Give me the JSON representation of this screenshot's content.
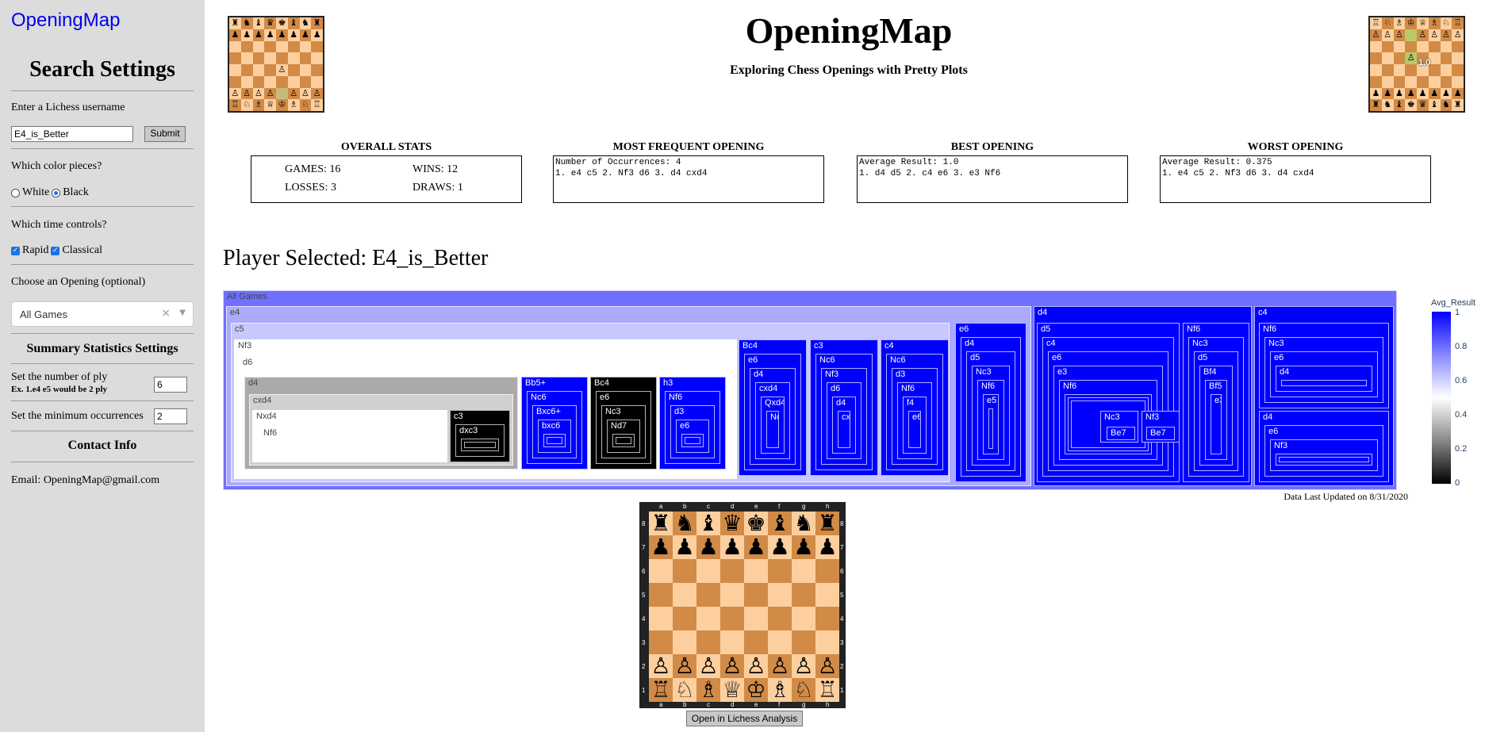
{
  "sidebar": {
    "brand": "OpeningMap",
    "heading": "Search Settings",
    "username_label": "Enter a Lichess username",
    "username_value": "E4_is_Better",
    "submit_label": "Submit",
    "color_label": "Which color pieces?",
    "color_options": [
      "White",
      "Black"
    ],
    "color_selected": "Black",
    "time_label": "Which time controls?",
    "time_options": [
      "Rapid",
      "Classical"
    ],
    "opening_label": "Choose an Opening (optional)",
    "opening_value": "All Games",
    "summary_heading": "Summary Statistics Settings",
    "ply_label": "Set the number of ply",
    "ply_hint": "Ex. 1.e4 e5 would be 2 ply",
    "ply_value": "6",
    "minocc_label": "Set the minimum occurrences",
    "minocc_value": "2",
    "contact_heading": "Contact Info",
    "email": "Email: OpeningMap@gmail.com"
  },
  "header": {
    "title": "OpeningMap",
    "subtitle": "Exploring Chess Openings with Pretty Plots",
    "right_board_overlay": "1.0"
  },
  "stats": {
    "overall_title": "OVERALL STATS",
    "games": "GAMES: 16",
    "wins": "WINS: 12",
    "losses": "LOSSES: 3",
    "draws": "DRAWS: 1",
    "frequent_title": "MOST FREQUENT OPENING",
    "frequent_line1": "Number of Occurrences: 4",
    "frequent_line2": "1. e4 c5 2. Nf3 d6 3. d4 cxd4",
    "best_title": "BEST OPENING",
    "best_line1": "Average Result: 1.0",
    "best_line2": "1. d4 d5 2. c4 e6 3. e3 Nf6",
    "worst_title": "WORST OPENING",
    "worst_line1": "Average Result: 0.375",
    "worst_line2": "1. e4 c5 2. Nf3 d6 3. d4 cxd4"
  },
  "player_heading": "Player Selected: E4_is_Better",
  "treemap": {
    "root_label": "All Games",
    "colorbar_title": "Avg_Result",
    "colorbar_ticks": [
      "1",
      "0.8",
      "0.6",
      "0.4",
      "0.2",
      "0"
    ],
    "labels": {
      "e4": "e4",
      "c5": "c5",
      "nf3": "Nf3",
      "d6": "d6",
      "d4": "d4",
      "cxd4": "cxd4",
      "nxd4": "Nxd4",
      "nf6": "Nf6",
      "c3": "c3",
      "dxc3": "dxc3",
      "bb5": "Bb5+",
      "nc6": "Nc6",
      "bxc6p": "Bxc6+",
      "bxc6": "bxc6",
      "bc4": "Bc4",
      "e6": "e6",
      "nc3": "Nc3",
      "nd7": "Nd7",
      "h3": "h3",
      "d3": "d3",
      "bc4b": "Bc4",
      "qxd4": "Qxd4",
      "c3b": "c3",
      "c4": "c4",
      "f4": "f4",
      "d5": "d5",
      "e5": "e5",
      "e3": "e3",
      "be7": "Be7",
      "bf4": "Bf4",
      "bf5": "Bf5"
    }
  },
  "updated": "Data Last Updated on 8/31/2020",
  "board": {
    "files": [
      "a",
      "b",
      "c",
      "d",
      "e",
      "f",
      "g",
      "h"
    ],
    "ranks": [
      "8",
      "7",
      "6",
      "5",
      "4",
      "3",
      "2",
      "1"
    ],
    "lichess_button": "Open in Lichess Analysis"
  },
  "colors": {
    "blue": "#0000ff",
    "mid_blue": "#6666ff",
    "light_blue": "#aaaaff",
    "sidebar": "#dcdcdc",
    "light_square": "#fecf9e",
    "dark_square": "#d18b47"
  }
}
